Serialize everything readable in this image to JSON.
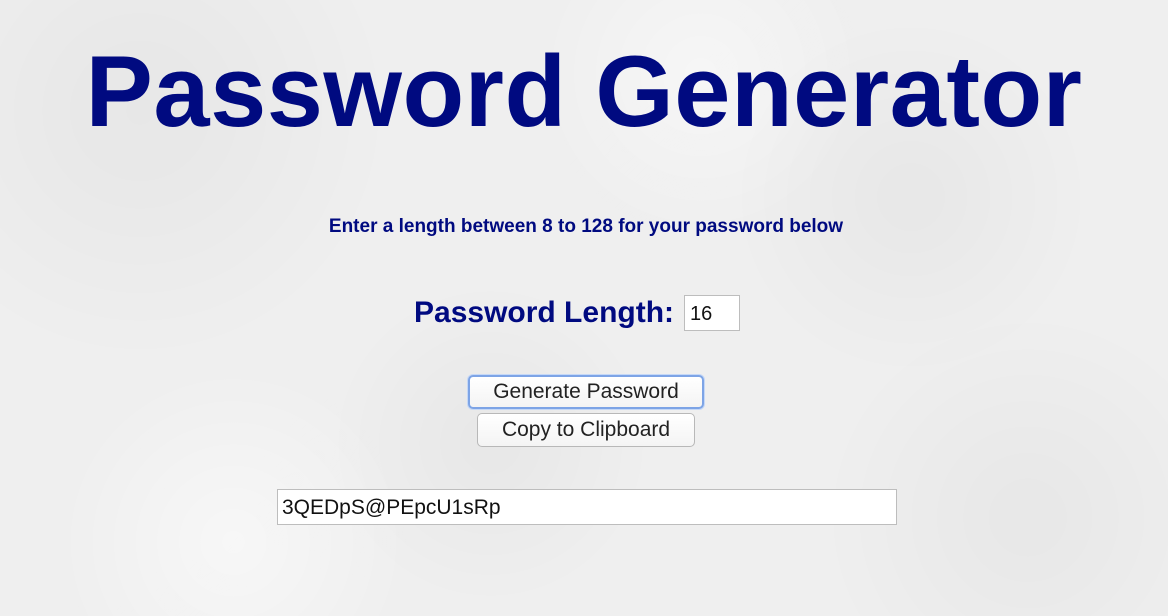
{
  "header": {
    "title": "Password Generator"
  },
  "main": {
    "instructions": "Enter a length between 8 to 128 for your password below",
    "length_label": "Password Length:",
    "length_value": "16",
    "generate_button_label": "Generate Password",
    "copy_button_label": "Copy to Clipboard",
    "generated_password": "3QEDpS@PEpcU1sRp"
  },
  "colors": {
    "heading": "#000a80",
    "background": "#efefef",
    "focus_ring": "#7da4e6"
  }
}
